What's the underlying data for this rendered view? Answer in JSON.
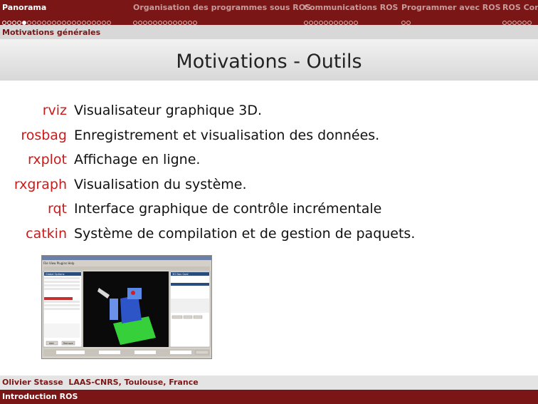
{
  "nav": {
    "sections": [
      {
        "label": "Panorama"
      },
      {
        "label": "Organisation des programmes sous ROS"
      },
      {
        "label": "Communications ROS"
      },
      {
        "label": "Programmer avec ROS"
      },
      {
        "label": "ROS Con"
      }
    ]
  },
  "subtitle": "Motivations générales",
  "title": "Motivations - Outils",
  "items": [
    {
      "key": "rviz",
      "desc": "Visualisateur graphique 3D."
    },
    {
      "key": "rosbag",
      "desc": "Enregistrement et visualisation des données."
    },
    {
      "key": "rxplot",
      "desc": "Affichage en ligne."
    },
    {
      "key": "rxgraph",
      "desc": "Visualisation du système."
    },
    {
      "key": "rqt",
      "desc": "Interface graphique de contrôle incrémentale"
    },
    {
      "key": "catkin",
      "desc": "Système de compilation et de gestion de paquets."
    }
  ],
  "screenshot_text": {
    "menu": "File  View  Plugins  Help",
    "panel_title": "Global Options",
    "display_title": "3D Nav Goal",
    "add_button": "Add",
    "remove_button": "Remove"
  },
  "footer": {
    "author": "Olivier Stasse",
    "affiliation": "LAAS-CNRS, Toulouse, France",
    "course": "Introduction ROS"
  },
  "colors": {
    "accent": "#7a1616",
    "key_text": "#cc1a1a"
  }
}
